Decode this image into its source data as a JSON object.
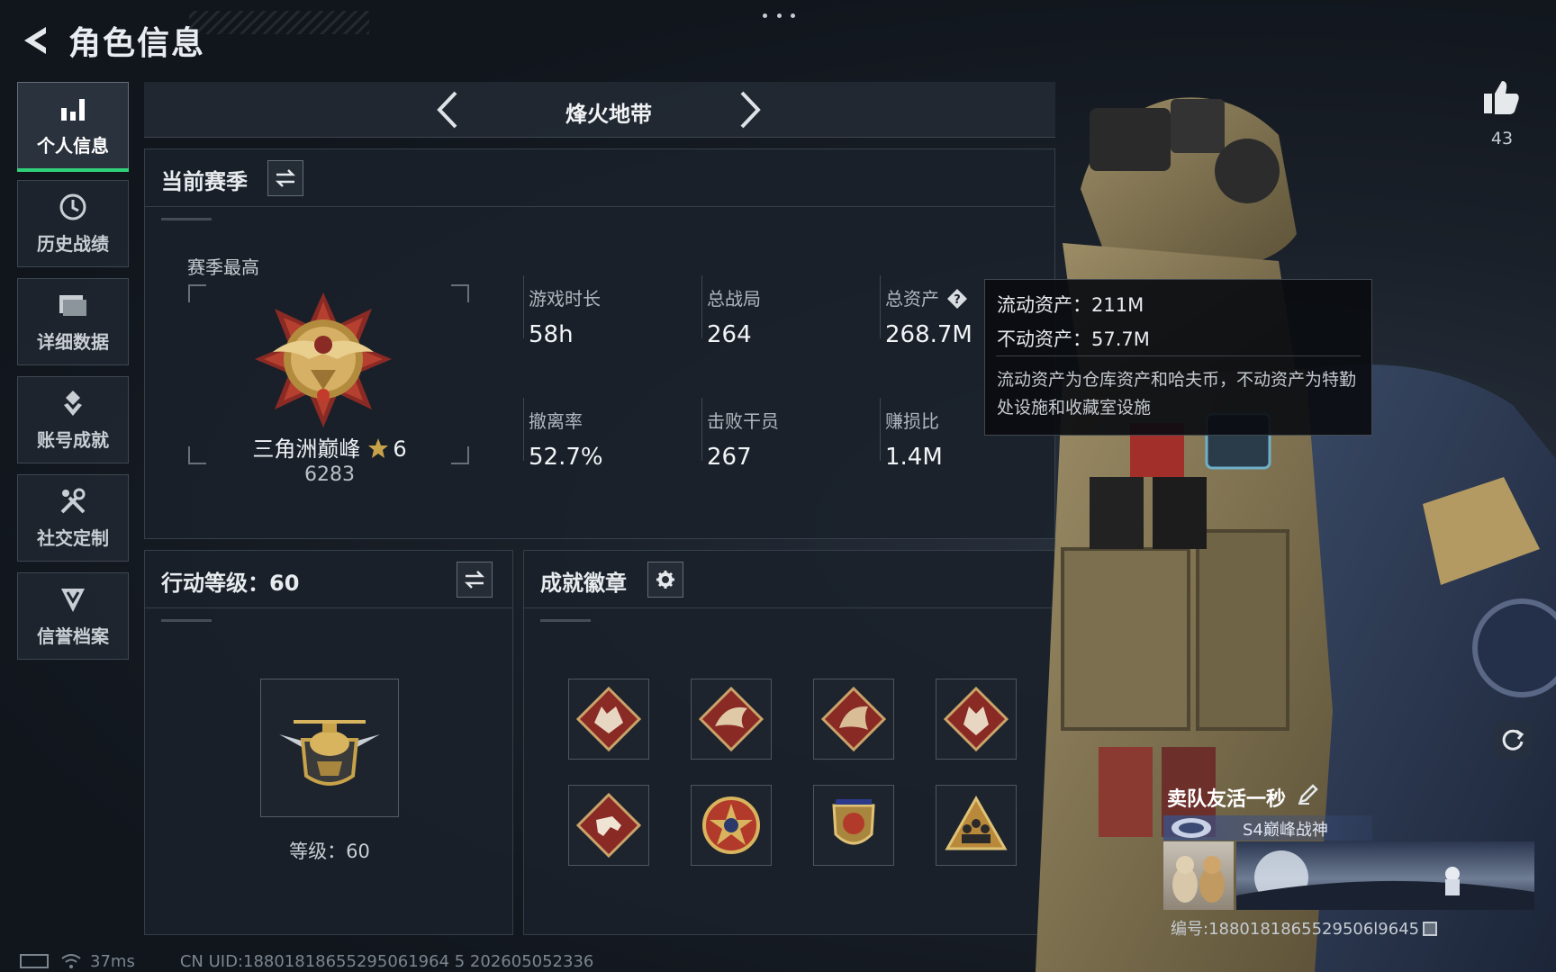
{
  "header": {
    "title": "角色信息"
  },
  "sidebar": {
    "items": [
      {
        "label": "个人信息",
        "icon": "bar-chart-icon",
        "active": true
      },
      {
        "label": "历史战绩",
        "icon": "history-icon"
      },
      {
        "label": "详细数据",
        "icon": "folder-icon"
      },
      {
        "label": "账号成就",
        "icon": "achievement-icon"
      },
      {
        "label": "社交定制",
        "icon": "tools-icon"
      },
      {
        "label": "信誉档案",
        "icon": "credibility-icon"
      }
    ]
  },
  "mode": {
    "title": "烽火地带"
  },
  "season": {
    "title": "当前赛季",
    "best_label": "赛季最高",
    "rank_name": "三角洲巅峰",
    "rank_stars": "6",
    "rank_score": "6283",
    "stats": [
      {
        "label": "游戏时长",
        "value": "58h"
      },
      {
        "label": "总战局",
        "value": "264"
      },
      {
        "label": "总资产",
        "value": "268.7M"
      },
      {
        "label": "撤离率",
        "value": "52.7%"
      },
      {
        "label": "击败干员",
        "value": "267"
      },
      {
        "label": "赚损比",
        "value": "1.4M"
      }
    ]
  },
  "tooltip": {
    "liquid": "流动资产：211M",
    "fixed": "不动资产：57.7M",
    "desc": "流动资产为仓库资产和哈夫币，不动资产为特勤处设施和收藏室设施"
  },
  "level": {
    "title": "行动等级：60",
    "caption": "等级：60"
  },
  "achievements": {
    "title": "成就徽章"
  },
  "likes": {
    "count": "43"
  },
  "player": {
    "name": "卖队友活一秒",
    "title": "S4巅峰战神",
    "id": "编号:1880181865529506l9645"
  },
  "footer": {
    "ping": "37ms",
    "uid": "CN UID:18801818655295061964 5 202605052336"
  },
  "colors": {
    "accent": "#2fd07a",
    "gold": "#c8a24a"
  }
}
